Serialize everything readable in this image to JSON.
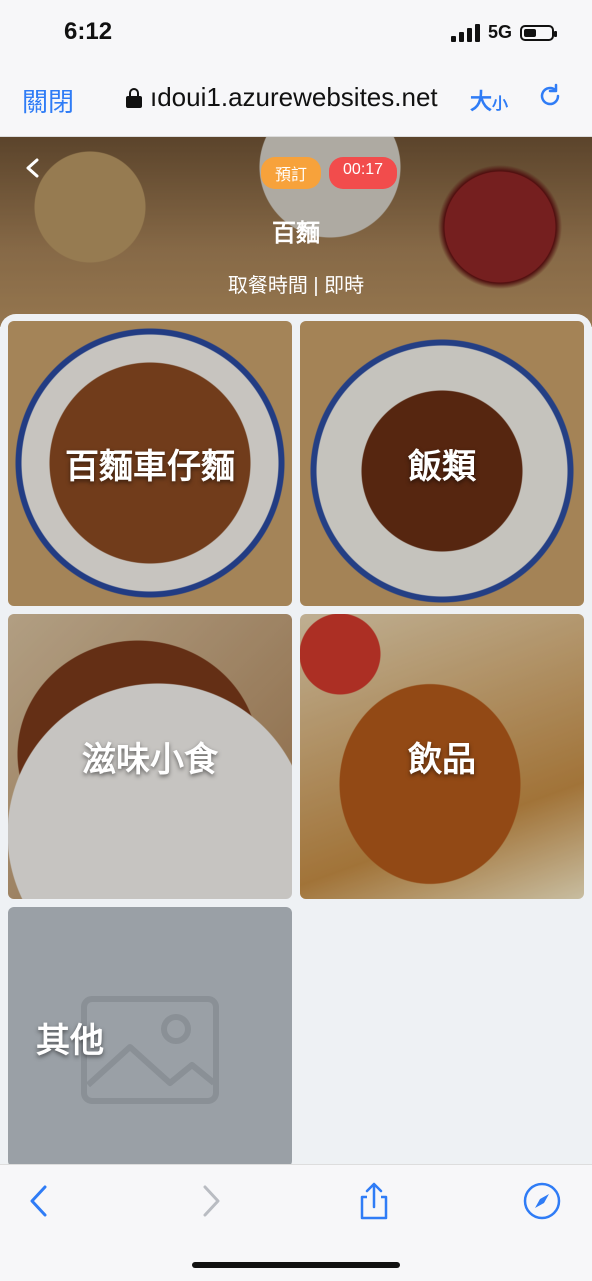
{
  "status": {
    "time": "6:12",
    "network": "5G"
  },
  "browser": {
    "close_label": "關閉",
    "url": "ıdoui1.azurewebsites.net",
    "size_label_main": "大",
    "size_label_small": "小"
  },
  "header": {
    "reserve_badge": "預訂",
    "timer": "00:17",
    "store_name": "百麵",
    "pickup_time": "取餐時間 | 即時"
  },
  "categories": [
    {
      "label": "百麵車仔麵"
    },
    {
      "label": "飯類"
    },
    {
      "label": "滋味小食"
    },
    {
      "label": "飲品"
    },
    {
      "label": "其他"
    }
  ],
  "colors": {
    "accent": "#2f7cf6",
    "reserve": "#f7a23b",
    "timer": "#f24c4c"
  },
  "icons": [
    "back-icon",
    "lock-icon",
    "reload-icon",
    "nav-back-icon",
    "nav-forward-icon",
    "share-icon",
    "compass-icon",
    "image-placeholder-icon"
  ]
}
